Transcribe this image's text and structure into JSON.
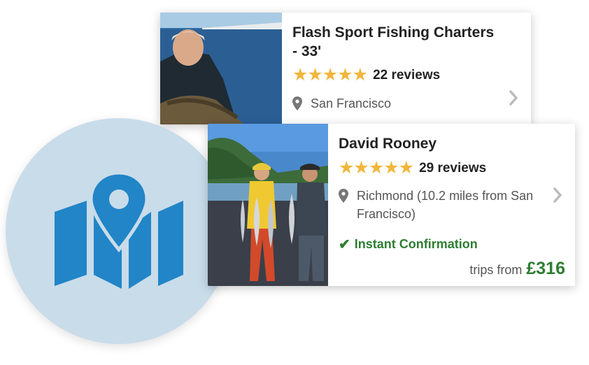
{
  "listings": [
    {
      "title": "Flash Sport Fishing Charters - 33'",
      "stars": "★★★★★",
      "reviews": "22 reviews",
      "location": "San Francisco"
    },
    {
      "title": "David Rooney",
      "stars": "★★★★★",
      "reviews": "29 reviews",
      "location": "Richmond (10.2 miles from San Francisco)",
      "confirmation": "Instant Confirmation",
      "price_prefix": "trips from",
      "price": "£316"
    }
  ],
  "colors": {
    "star": "#f2b63c",
    "confirm_green": "#2e7d32",
    "map_icon_blue": "#2185c7",
    "circle_bg": "#c9dcea"
  },
  "icons": [
    "map-pin-icon",
    "location-pin-icon",
    "chevron-right-icon",
    "checkmark-icon",
    "star-icon"
  ]
}
